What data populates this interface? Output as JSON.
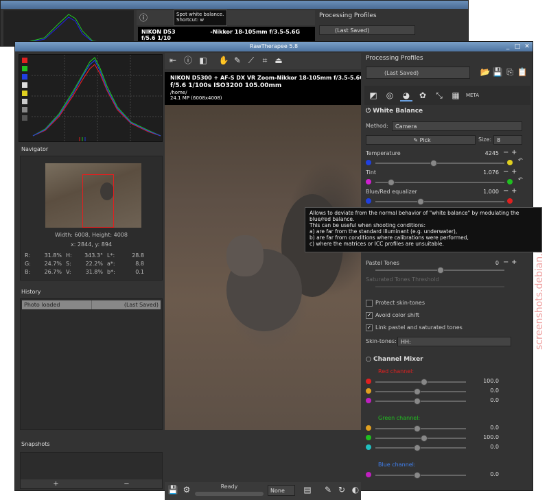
{
  "bg_window": {
    "info_line": "NIKON D53",
    "info_line_b": "-Nikkor 18-105mm f/3.5-5.6G",
    "info_line2": "f/5.6 1/10",
    "tooltip": "Spot white balance.\nShortcut: w",
    "processing_profiles_label": "Processing Profiles",
    "profile_value": "(Last Saved)"
  },
  "window": {
    "title": "RawTherapee 5.8"
  },
  "left": {
    "navigator_label": "Navigator",
    "width_height": "Width: 6008, Height: 4008",
    "xy": "x: 2844, y: 894",
    "readouts": [
      {
        "l1": "R:",
        "v1": "31.8%",
        "l2": "H:",
        "v2": "343.3°",
        "l3": "L*:",
        "v3": "28.8"
      },
      {
        "l1": "G:",
        "v1": "24.7%",
        "l2": "S:",
        "v2": "22.2%",
        "l3": "a*:",
        "v3": "8.8"
      },
      {
        "l1": "B:",
        "v1": "26.7%",
        "l2": "V:",
        "v2": "31.8%",
        "l3": "b*:",
        "v3": "0.1"
      }
    ],
    "history_label": "History",
    "history_rows": [
      {
        "c1": "Photo loaded",
        "c2": "(Last Saved)"
      }
    ],
    "snapshots_label": "Snapshots",
    "snap_add": "+",
    "snap_remove": "−"
  },
  "center": {
    "info_line1": "NIKON D5300 + AF-S DX VR Zoom-Nikkor 18-105mm f/3.5-5.6G",
    "info_line2": "f/5.6  1/100s  ISO3200  105.00mm",
    "info_line3": "/home/",
    "info_line4": "24.1 MP (6008x4008)",
    "status": "Ready",
    "view_select": "None"
  },
  "right": {
    "processing_profiles_label": "Processing Profiles",
    "profile_value": "(Last Saved)",
    "wb_title": "White Balance",
    "method_label": "Method:",
    "method_value": "Camera",
    "pick_label": "Pick",
    "size_label": "Size:",
    "size_value": "8",
    "temperature_label": "Temperature",
    "temperature_value": "4245",
    "temperature_level": 0.45,
    "tint_label": "Tint",
    "tint_value": "1.076",
    "tint_level": 0.12,
    "bluered_label": "Blue/Red equalizer",
    "bluered_value": "1.000",
    "bluered_level": 0.35,
    "pastel_label": "Pastel Tones",
    "pastel_value": "0",
    "saturated_label": "Saturated Tones Threshold",
    "protect_label": "Protect skin-tones",
    "avoid_label": "Avoid color shift",
    "link_label": "Link pastel and saturated tones",
    "skintones_label": "Skin-tones:",
    "skintones_value": "HH:",
    "mixer_title": "Channel Mixer",
    "red_channel": "Red channel:",
    "green_channel": "Green channel:",
    "blue_channel": "Blue channel:",
    "red_vals": [
      "100.0",
      "0.0",
      "0.0"
    ],
    "green_vals": [
      "0.0",
      "100.0",
      "0.0"
    ],
    "blue_vals": [
      "0.0"
    ]
  },
  "tooltip": "Allows to deviate from the normal behavior of \"white balance\" by modulating the blue/red balance.\nThis can be useful when shooting conditions:\na) are far from the standard illuminant (e.g. underwater),\nb) are far from conditions where calibrations were performed,\nc) where the matrices or ICC profiles are unsuitable.",
  "watermark": "screenshots.debian.net",
  "colors": {
    "red": "#e02020",
    "green": "#20c020",
    "blue": "#2040e0",
    "accent": "#4d73a0"
  }
}
